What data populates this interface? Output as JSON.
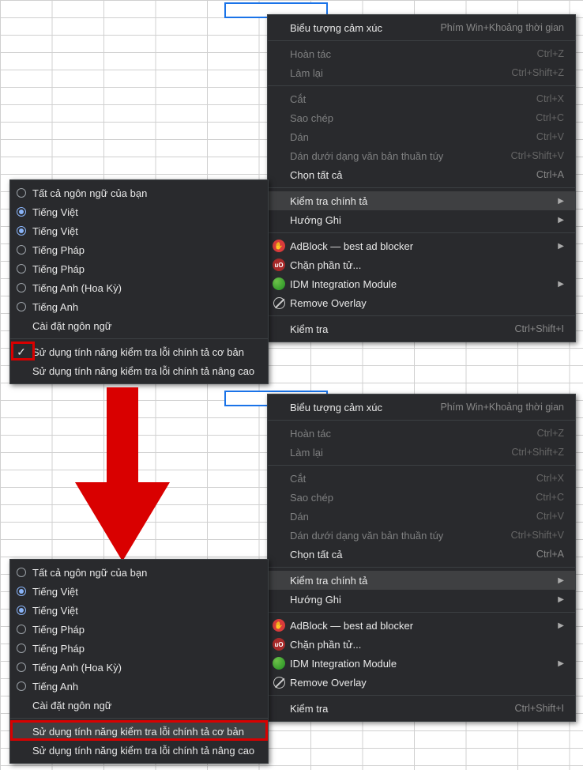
{
  "contextMenu": {
    "emoji": {
      "label": "Biểu tượng cảm xúc",
      "shortcut": "Phím Win+Khoảng thời gian"
    },
    "undo": {
      "label": "Hoàn tác",
      "shortcut": "Ctrl+Z"
    },
    "redo": {
      "label": "Làm lại",
      "shortcut": "Ctrl+Shift+Z"
    },
    "cut": {
      "label": "Cắt",
      "shortcut": "Ctrl+X"
    },
    "copy": {
      "label": "Sao chép",
      "shortcut": "Ctrl+C"
    },
    "paste": {
      "label": "Dán",
      "shortcut": "Ctrl+V"
    },
    "pastePlain": {
      "label": "Dán dưới dạng văn bản thuần túy",
      "shortcut": "Ctrl+Shift+V"
    },
    "selectAll": {
      "label": "Chọn tất cả",
      "shortcut": "Ctrl+A"
    },
    "spellcheck": {
      "label": "Kiểm tra chính tả"
    },
    "writingDir": {
      "label": "Hướng Ghi"
    },
    "adblock": {
      "label": "AdBlock — best ad blocker"
    },
    "blockElem": {
      "label": "Chặn phần tử..."
    },
    "idm": {
      "label": "IDM Integration Module"
    },
    "removeOverlay": {
      "label": "Remove Overlay"
    },
    "inspect": {
      "label": "Kiểm tra",
      "shortcut": "Ctrl+Shift+I"
    }
  },
  "spellSubmenu": {
    "allLangs": {
      "label": "Tất cả ngôn ngữ của bạn"
    },
    "viet1": {
      "label": "Tiếng Việt"
    },
    "viet2": {
      "label": "Tiếng Việt"
    },
    "fr1": {
      "label": "Tiếng Pháp"
    },
    "fr2": {
      "label": "Tiếng Pháp"
    },
    "enUS": {
      "label": "Tiếng Anh (Hoa Kỳ)"
    },
    "en": {
      "label": "Tiếng Anh"
    },
    "langSettings": {
      "label": "Cài đặt ngôn ngữ"
    },
    "basicCheck": {
      "label": "Sử dụng tính năng kiểm tra lỗi chính tả cơ bản"
    },
    "advCheck": {
      "label": "Sử dụng tính năng kiểm tra lỗi chính tả nâng cao"
    }
  }
}
